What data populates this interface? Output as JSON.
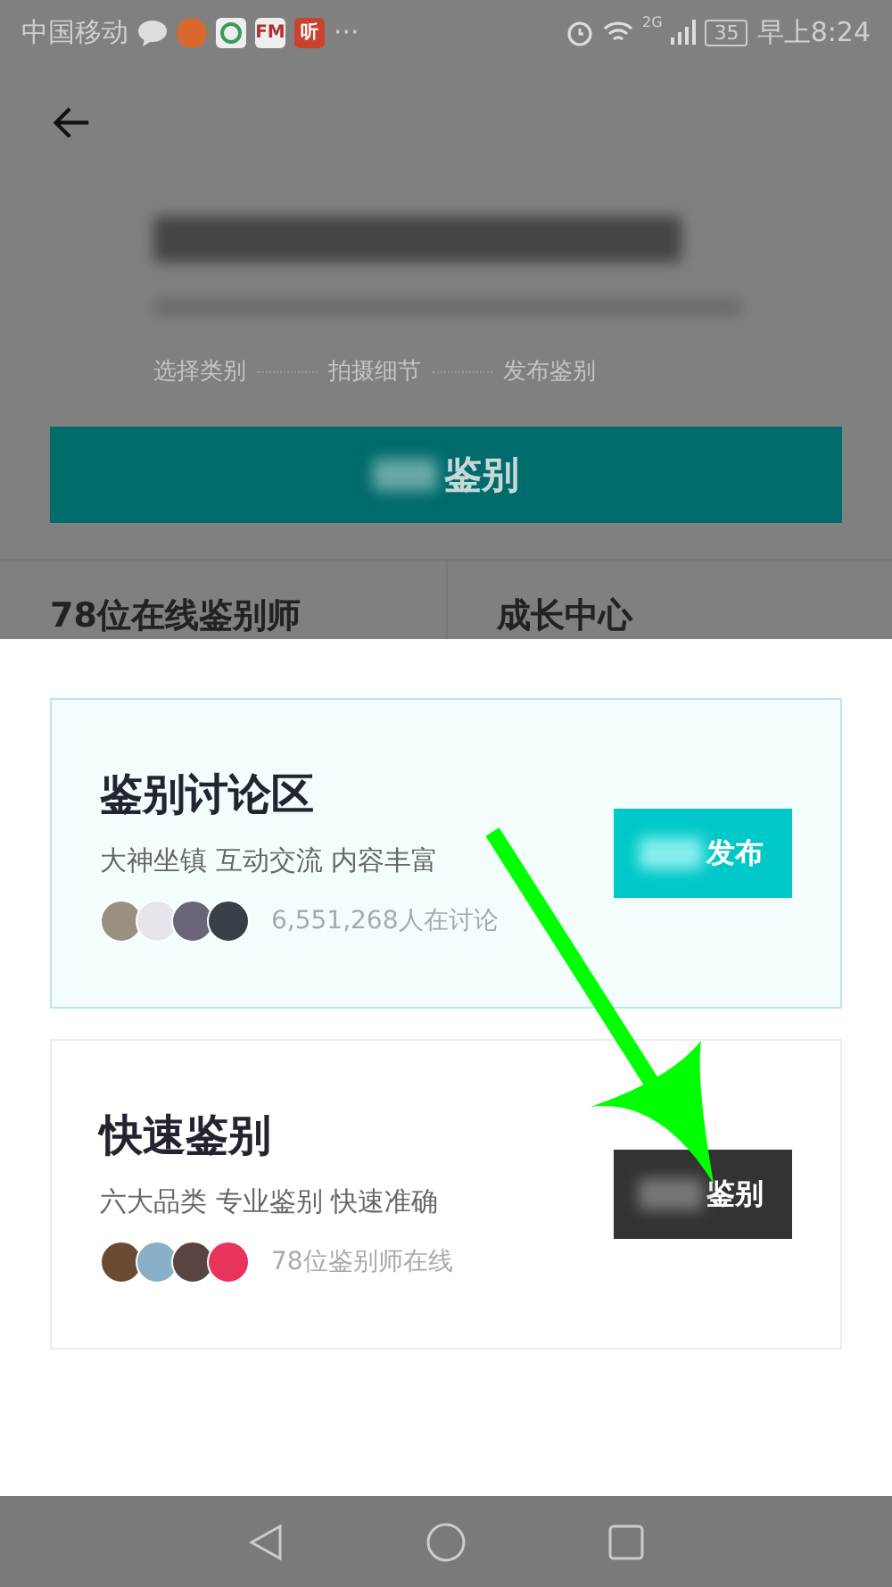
{
  "status_bar": {
    "carrier": "中国移动",
    "apps": [
      {
        "kind": "chat"
      },
      {
        "kind": "badge",
        "color": "#d9682e"
      },
      {
        "kind": "ring"
      },
      {
        "kind": "label",
        "label": "FM",
        "color": "#eeeeee"
      },
      {
        "kind": "label",
        "label": "听",
        "color": "#c9432c"
      }
    ],
    "more": "···",
    "network": "2G",
    "battery": "35",
    "time": "早上8:24"
  },
  "page": {
    "steps": [
      "选择类别",
      "拍摄细节",
      "发布鉴别"
    ],
    "main_button": "鉴别",
    "tiles": [
      "78位在线鉴别师",
      "成长中心"
    ]
  },
  "cards": [
    {
      "kind": "highlight",
      "title": "鉴别讨论区",
      "subtitle": "大神坐镇 互动交流 内容丰富",
      "count": "6,551,268人在讨论",
      "button": "发布",
      "avatars": [
        {
          "color": "#9a9080"
        },
        {
          "color": "#e8e4ec"
        },
        {
          "color": "#6a6478"
        },
        {
          "color": "#3a4048"
        }
      ]
    },
    {
      "kind": "plain",
      "title": "快速鉴别",
      "subtitle": "六大品类 专业鉴别 快速准确",
      "count": "78位鉴别师在线",
      "button": "鉴别",
      "avatars": [
        {
          "color": "#6b4a32"
        },
        {
          "color": "#8ab0c8"
        },
        {
          "color": "#5a4440"
        },
        {
          "color": "#e8345a"
        }
      ]
    }
  ],
  "annotation": {
    "kind": "arrow"
  }
}
